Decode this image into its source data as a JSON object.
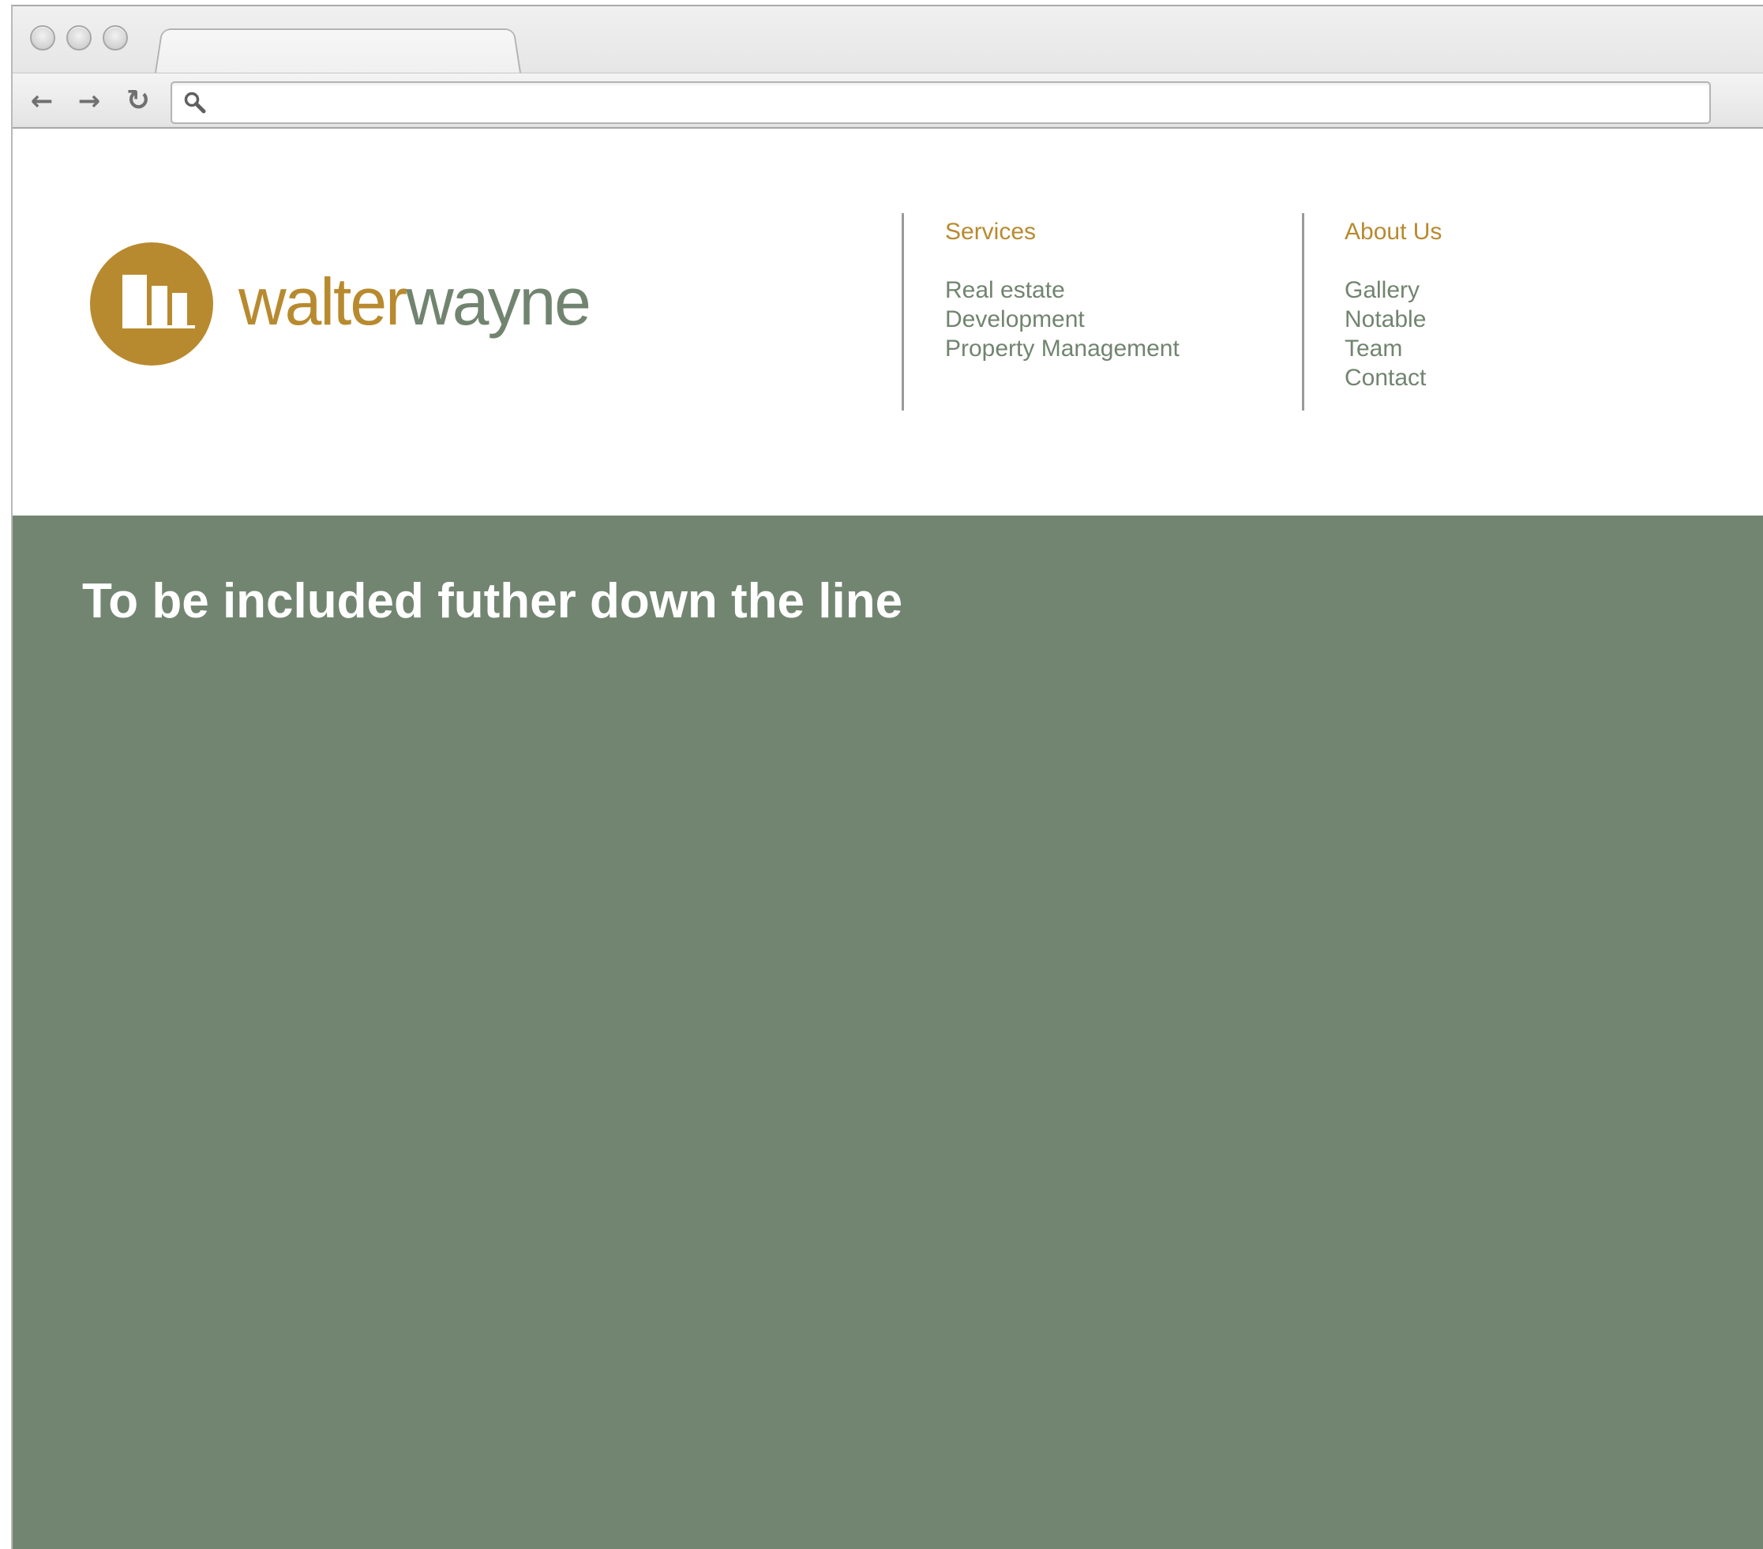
{
  "browser": {
    "tab_title": "",
    "address": {
      "value": "",
      "placeholder": ""
    },
    "nav": {
      "back_glyph": "←",
      "forward_glyph": "→",
      "reload_glyph": "↻"
    }
  },
  "site": {
    "logo": {
      "brand_part_1": "walter",
      "brand_part_2": "wayne",
      "colors": {
        "gold": "#b88a2f",
        "sage": "#71846f"
      }
    },
    "nav": {
      "services": {
        "heading": "Services",
        "links": [
          "Real estate",
          "Development",
          "Property Management"
        ]
      },
      "about": {
        "heading": "About Us",
        "links": [
          "Gallery",
          "Notable",
          "Team",
          "Contact"
        ]
      }
    },
    "main_panel": {
      "title": "To be included futher down the line",
      "background": "#728571"
    }
  },
  "icons": {
    "window_controls": [
      "close-icon",
      "minimize-icon",
      "zoom-icon"
    ],
    "search": "search-icon",
    "back": "arrow-left-icon",
    "forward": "arrow-right-icon",
    "reload": "reload-icon"
  }
}
